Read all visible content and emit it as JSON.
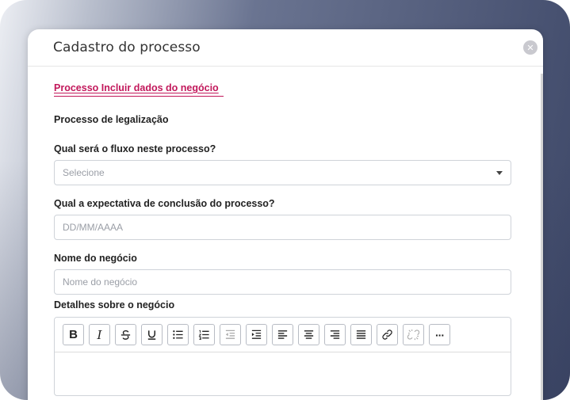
{
  "modal": {
    "title": "Cadastro do processo",
    "close_icon": "close-icon"
  },
  "tab": {
    "label": "Processo  Incluir dados do negócio"
  },
  "form": {
    "section_heading": "Processo de legalização",
    "flow_label": "Qual será o fluxo neste processo?",
    "flow_select_value": "Selecione",
    "deadline_label": "Qual a expectativa de conclusão do processo?",
    "deadline_placeholder": "DD/MM/AAAA",
    "business_name_label": "Nome do negócio",
    "business_name_placeholder": "Nome do negócio",
    "details_label": "Detalhes sobre o negócio"
  },
  "toolbar": {
    "bold": "B",
    "italic": "I",
    "more": "···",
    "icons": [
      "bold-icon",
      "italic-icon",
      "strikethrough-icon",
      "underline-icon",
      "bullet-list-icon",
      "numbered-list-icon",
      "outdent-icon",
      "indent-icon",
      "align-left-icon",
      "align-center-icon",
      "align-right-icon",
      "justify-icon",
      "link-icon",
      "unlink-icon",
      "more-icon"
    ]
  },
  "colors": {
    "accent": "#c2185b",
    "border": "#cfd3d9"
  }
}
